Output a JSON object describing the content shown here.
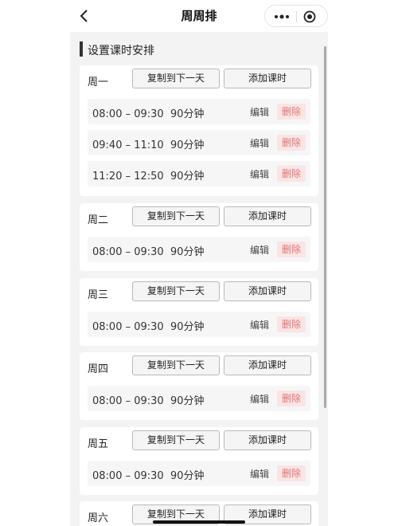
{
  "nav": {
    "title": "周周排",
    "back_icon": "chevron-left-icon",
    "more_icon": "more-icon",
    "target_icon": "target-icon"
  },
  "section": {
    "title": "设置课时安排"
  },
  "copy_label": "复制到下一天",
  "add_label": "添加课时",
  "edit_label": "编辑",
  "delete_label": "删除",
  "days": [
    {
      "name": "周一",
      "slots": [
        {
          "time": "08:00 – 09:30",
          "duration": "90分钟"
        },
        {
          "time": "09:40 – 11:10",
          "duration": "90分钟"
        },
        {
          "time": "11:20 – 12:50",
          "duration": "90分钟"
        }
      ]
    },
    {
      "name": "周二",
      "slots": [
        {
          "time": "08:00 – 09:30",
          "duration": "90分钟"
        }
      ]
    },
    {
      "name": "周三",
      "slots": [
        {
          "time": "08:00 – 09:30",
          "duration": "90分钟"
        }
      ]
    },
    {
      "name": "周四",
      "slots": [
        {
          "time": "08:00 – 09:30",
          "duration": "90分钟"
        }
      ]
    },
    {
      "name": "周五",
      "slots": [
        {
          "time": "08:00 – 09:30",
          "duration": "90分钟"
        }
      ]
    },
    {
      "name": "周六",
      "slots": []
    }
  ],
  "colors": {
    "delete_bg": "#fbe4e4",
    "delete_text": "#e07575",
    "section_bar": "#333333"
  }
}
